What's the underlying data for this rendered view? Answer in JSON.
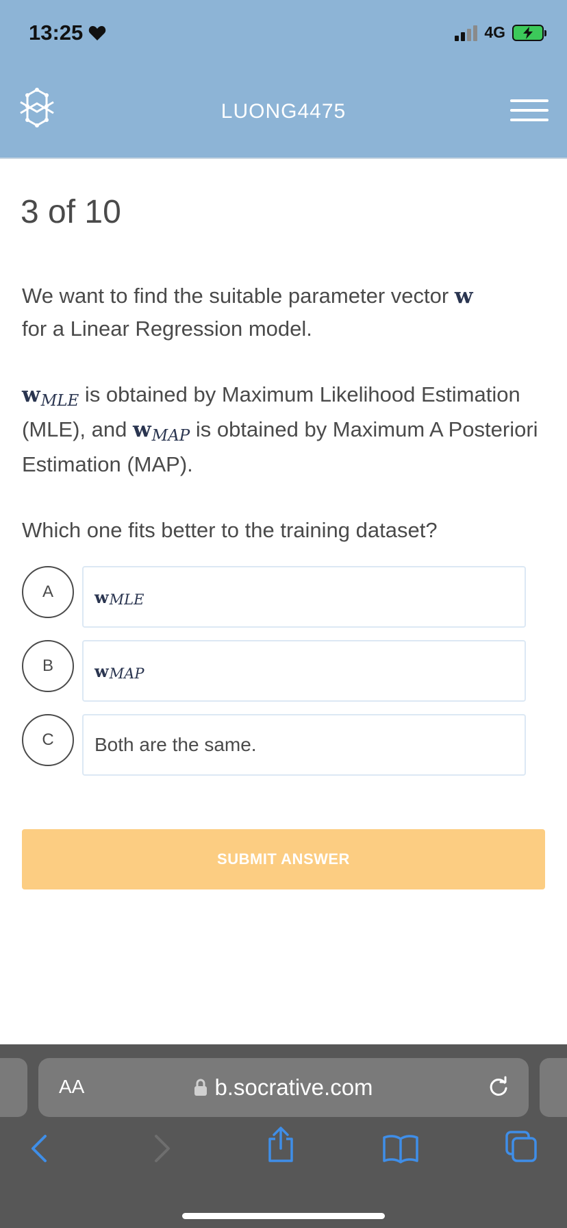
{
  "status_bar": {
    "time": "13:25",
    "network": "4G"
  },
  "header": {
    "title": "LUONG4475"
  },
  "progress": "3 of 10",
  "question": {
    "line1_text": "We want to find the suitable parameter vector ",
    "vec": "w",
    "line1_end": "for a Linear Regression model.",
    "mle_sub": "MLE",
    "map_sub": "MAP",
    "p2_a": " is obtained by Maximum Likelihood Estimation (MLE), and ",
    "p2_b": " is obtained by Maximum A Posteriori Estimation (MAP).",
    "prompt": "Which one fits better to the training dataset?"
  },
  "options": [
    {
      "letter": "A",
      "vec": "w",
      "sub": "MLE"
    },
    {
      "letter": "B",
      "vec": "w",
      "sub": "MAP"
    },
    {
      "letter": "C",
      "text": "Both are the same."
    }
  ],
  "submit_label": "SUBMIT ANSWER",
  "browser": {
    "text_size_label": "AA",
    "url": "b.socrative.com"
  }
}
